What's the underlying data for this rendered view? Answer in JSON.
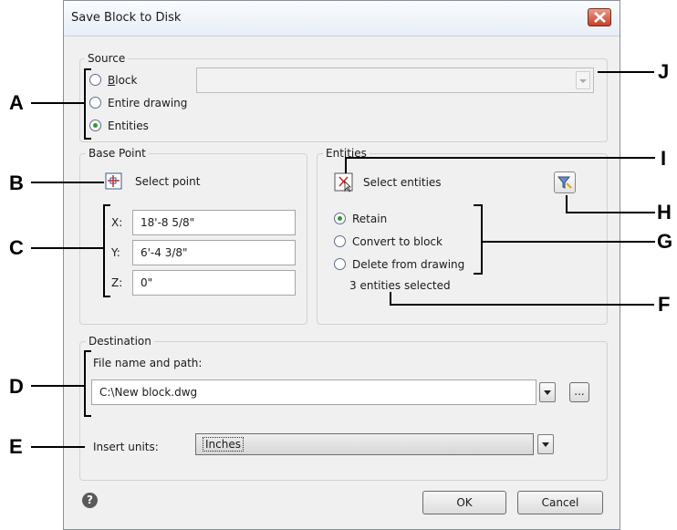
{
  "dialog": {
    "title": "Save Block to Disk",
    "close_icon": "close-icon"
  },
  "source": {
    "legend": "Source",
    "options": [
      "Block",
      "Entire drawing",
      "Entities"
    ],
    "selected": "Entities",
    "block_dropdown_value": ""
  },
  "base_point": {
    "legend": "Base Point",
    "select_point_label": "Select point",
    "x_label": "X:",
    "x_value": "18'-8 5/8\"",
    "y_label": "Y:",
    "y_value": "6'-4 3/8\"",
    "z_label": "Z:",
    "z_value": "0\""
  },
  "entities": {
    "legend": "Entities",
    "select_entities_label": "Select entities",
    "options": [
      "Retain",
      "Convert to block",
      "Delete from drawing"
    ],
    "selected": "Retain",
    "status": "3 entities selected"
  },
  "destination": {
    "legend": "Destination",
    "file_label": "File name and path:",
    "file_value": "C:\\New block.dwg",
    "browse_label": "...",
    "insert_units_label": "Insert units:",
    "insert_units_value": "Inches"
  },
  "footer": {
    "help_label": "?",
    "ok_label": "OK",
    "cancel_label": "Cancel"
  },
  "callouts": [
    "A",
    "B",
    "C",
    "D",
    "E",
    "F",
    "G",
    "H",
    "I",
    "J"
  ],
  "colors": {
    "dialog_bg": "#f0f0f0",
    "close_button": "#c6402a",
    "radio_selected": "#2a9a34"
  }
}
